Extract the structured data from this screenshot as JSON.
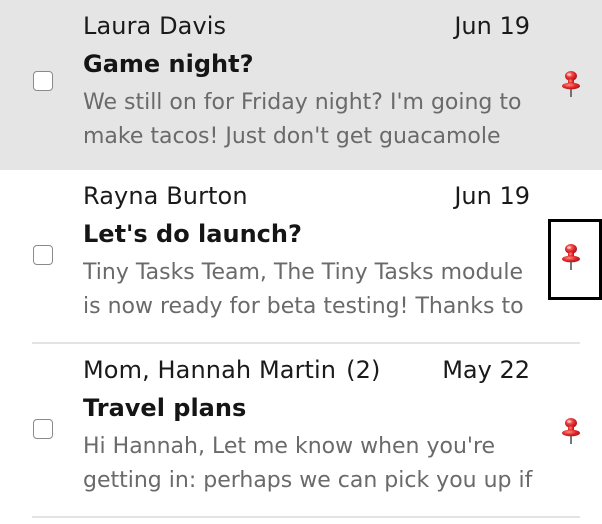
{
  "messages": [
    {
      "sender": "Laura Davis",
      "count": "",
      "date": "Jun 19",
      "subject": "Game night?",
      "preview": "We still on for Friday night? I'm going to make tacos! Just don't get guacamole all",
      "pinned": true,
      "selected": false
    },
    {
      "sender": "Rayna Burton",
      "count": "",
      "date": "Jun 19",
      "subject": "Let's do launch?",
      "preview": "Tiny Tasks Team, The Tiny Tasks module is now ready for beta testing! Thanks to",
      "pinned": true,
      "selected": false
    },
    {
      "sender": "Mom, Hannah Martin",
      "count": "(2)",
      "date": "May 22",
      "subject": "Travel plans",
      "preview": "Hi Hannah, Let me know when you're getting in: perhaps we can pick you up if",
      "pinned": true,
      "selected": false
    }
  ],
  "icons": {
    "pin": "pushpin-icon"
  },
  "colors": {
    "highlighted_row_bg": "#e5e5e5",
    "pin_red": "#e0262a",
    "preview_text": "#6a6a6a"
  }
}
